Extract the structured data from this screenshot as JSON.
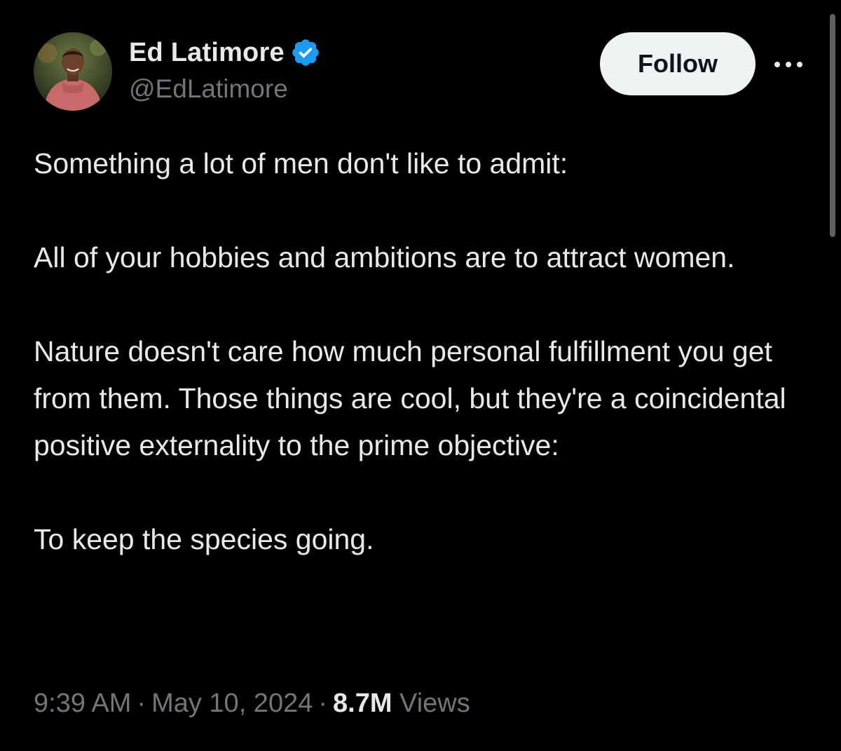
{
  "author": {
    "display_name": "Ed Latimore",
    "handle": "@EdLatimore",
    "verified": true,
    "avatar_icon": "profile-photo"
  },
  "actions": {
    "follow_label": "Follow",
    "more_icon": "more-horizontal-icon"
  },
  "tweet": {
    "paragraphs": [
      "Something a lot of men don't like to admit:",
      "All of your hobbies and ambitions are to attract women.",
      "Nature doesn't care how much personal fulfillment you get from them. Those things are cool, but they're a coincidental positive externality to the prime objective:",
      "To keep the species going."
    ]
  },
  "meta": {
    "time": "9:39 AM",
    "separator": "·",
    "date": "May 10, 2024",
    "views_count": "8.7M",
    "views_label": "Views"
  },
  "colors": {
    "background": "#000000",
    "text_primary": "#e7e9ea",
    "text_secondary": "#71767b",
    "verified_blue": "#1d9bf0",
    "follow_bg": "#eff3f4"
  }
}
